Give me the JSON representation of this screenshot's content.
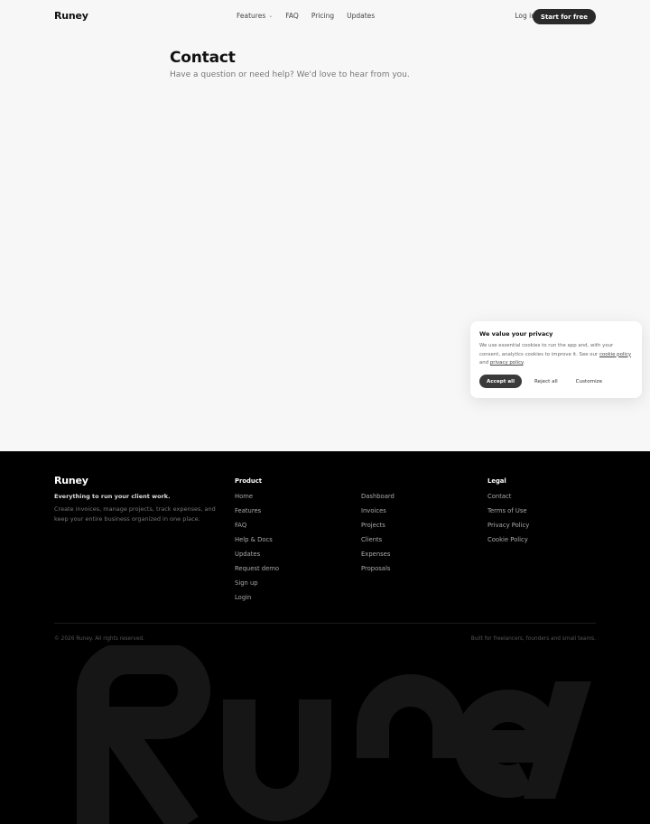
{
  "header": {
    "logo": "Runey",
    "nav": [
      {
        "label": "Features",
        "has_dropdown": true
      },
      {
        "label": "FAQ"
      },
      {
        "label": "Pricing"
      },
      {
        "label": "Updates"
      }
    ],
    "login": "Log in",
    "cta": "Start for free"
  },
  "main": {
    "title": "Contact",
    "subtitle": "Have a question or need help? We'd love to hear from you."
  },
  "cookie": {
    "title": "We value your privacy",
    "text_before": "We use essential cookies to run the app and, with your consent, analytics cookies to improve it. See our ",
    "cookie_link": "cookie policy",
    "text_mid": " and ",
    "privacy_link": "privacy policy",
    "text_after": ".",
    "accept": "Accept all",
    "reject": "Reject all",
    "customize": "Customize"
  },
  "footer": {
    "logo": "Runey",
    "tagline": "Everything to run your client work.",
    "description": "Create invoices, manage projects, track expenses, and keep your entire business organized in one place.",
    "product_heading": "Product",
    "product_links": [
      "Home",
      "Features",
      "FAQ",
      "Help & Docs",
      "Updates",
      "Request demo",
      "Sign up",
      "Login"
    ],
    "product2_links": [
      "Dashboard",
      "Invoices",
      "Projects",
      "Clients",
      "Expenses",
      "Proposals"
    ],
    "legal_heading": "Legal",
    "legal_links": [
      "Contact",
      "Terms of Use",
      "Privacy Policy",
      "Cookie Policy"
    ],
    "copyright": "© 2026 Runey. All rights reserved.",
    "built_for": "Built for freelancers, founders and small teams."
  },
  "colors": {
    "background": "#f7f7f7",
    "footer_bg": "#000000",
    "cta_bg": "#2a2a2a",
    "wordmark": "#161616"
  }
}
